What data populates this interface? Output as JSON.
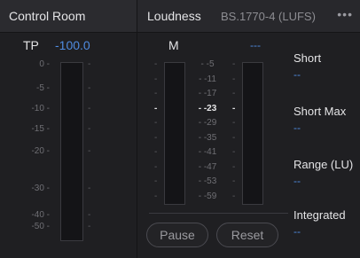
{
  "left_panel": {
    "title": "Control Room",
    "tp_label": "TP",
    "tp_value": "-100.0",
    "scale": [
      "0",
      "-5",
      "-10",
      "-15",
      "-20",
      "-30",
      "-40",
      "-50"
    ]
  },
  "right_panel": {
    "title": "Loudness",
    "standard": "BS.1770-4 (LUFS)",
    "more_icon": "•••",
    "m_label": "M",
    "second_value": "---",
    "scale": [
      "-5",
      "-11",
      "-17",
      "-23",
      "-29",
      "-35",
      "-41",
      "-47",
      "-53",
      "-59"
    ],
    "highlight": "-23",
    "readouts": [
      {
        "label": "Short",
        "value": "--"
      },
      {
        "label": "Short Max",
        "value": "--"
      },
      {
        "label": "Range (LU)",
        "value": "--"
      },
      {
        "label": "Integrated",
        "value": "--"
      }
    ],
    "pause_label": "Pause",
    "reset_label": "Reset"
  },
  "colors": {
    "accent_blue": "#4f8be0",
    "background": "#1f1f22"
  }
}
